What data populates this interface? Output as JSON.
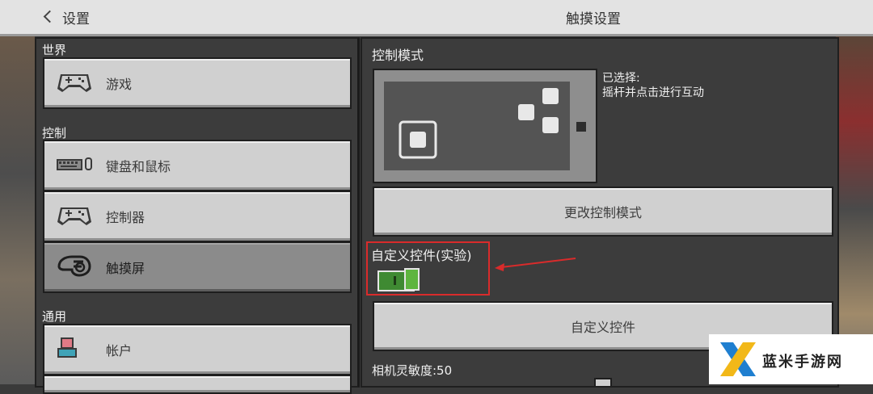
{
  "header": {
    "back_label": "设置",
    "page_title": "触摸设置"
  },
  "sidebar": {
    "sections": [
      {
        "label": "世界"
      },
      {
        "label": "控制"
      },
      {
        "label": "通用"
      }
    ],
    "items": [
      {
        "label": "游戏",
        "icon": "gamepad-icon"
      },
      {
        "label": "键盘和鼠标",
        "icon": "keyboard-mouse-icon"
      },
      {
        "label": "控制器",
        "icon": "controller-icon"
      },
      {
        "label": "触摸屏",
        "icon": "touch-hand-icon",
        "active": true
      },
      {
        "label": "帐户",
        "icon": "account-icon"
      }
    ]
  },
  "main": {
    "control_mode_title": "控制模式",
    "selected_title": "已选择:",
    "selected_value": "摇杆并点击进行互动",
    "change_mode_button": "更改控制模式",
    "custom_controls_label": "自定义控件(实验)",
    "custom_controls_enabled": true,
    "custom_controls_button": "自定义控件",
    "camera_sensitivity_label": "相机灵敏度:50"
  },
  "colors": {
    "annotation_red": "#d92b2b",
    "toggle_green": "#5eb53f"
  },
  "watermark": {
    "text": "蓝米手游网"
  }
}
